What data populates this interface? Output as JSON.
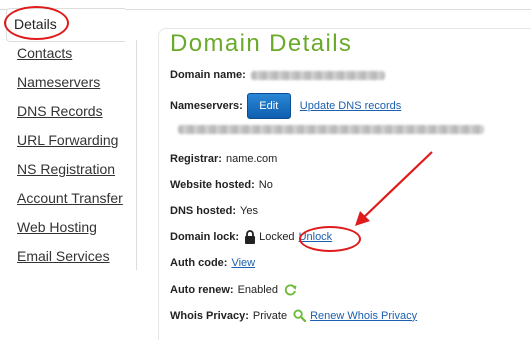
{
  "sidebar": {
    "active_tab": "Details",
    "items": [
      {
        "label": "Contacts"
      },
      {
        "label": "Nameservers"
      },
      {
        "label": "DNS Records"
      },
      {
        "label": "URL Forwarding"
      },
      {
        "label": "NS Registration"
      },
      {
        "label": "Account Transfer"
      },
      {
        "label": "Web Hosting"
      },
      {
        "label": "Email Services"
      }
    ]
  },
  "main": {
    "title": "Domain Details",
    "domain_name": {
      "label": "Domain name:"
    },
    "nameservers": {
      "label": "Nameservers:",
      "edit_button": "Edit",
      "update_link": "Update DNS records"
    },
    "registrar": {
      "label": "Registrar:",
      "value": "name.com"
    },
    "website_hosted": {
      "label": "Website hosted:",
      "value": "No"
    },
    "dns_hosted": {
      "label": "DNS hosted:",
      "value": "Yes"
    },
    "domain_lock": {
      "label": "Domain lock:",
      "value": "Locked",
      "action": "Unlock"
    },
    "auth_code": {
      "label": "Auth code:",
      "action": "View"
    },
    "auto_renew": {
      "label": "Auto renew:",
      "value": "Enabled"
    },
    "whois_privacy": {
      "label": "Whois Privacy:",
      "value": "Private",
      "action": "Renew Whois Privacy"
    }
  },
  "colors": {
    "title_green": "#6aaa2a",
    "link_blue": "#1b5fb0",
    "button_blue": "#1570c4",
    "annotation_red": "#e01b1b"
  },
  "icons": [
    "lock-icon",
    "refresh-icon",
    "search-icon"
  ]
}
